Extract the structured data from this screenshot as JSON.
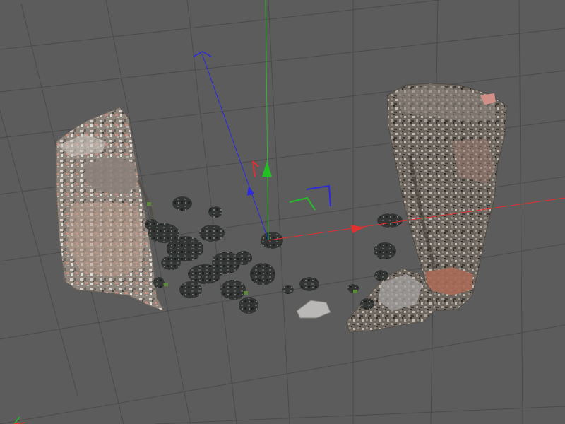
{
  "viewport": {
    "view_name": "3D viewport",
    "background": "#5c5c5c",
    "grid_color": "#4a4a4a",
    "grid_visible": true
  },
  "axes": {
    "x_color": "#e03030",
    "y_color": "#22c022",
    "z_color": "#2a2ae0"
  },
  "scene": {
    "objects": [
      {
        "id": "stone-wall-left",
        "kind": "point-cloud-scan",
        "tone": "#a89f98"
      },
      {
        "id": "stone-wall-right",
        "kind": "point-cloud-scan",
        "tone": "#7e766c"
      },
      {
        "id": "ground-debris",
        "kind": "point-cloud-scan",
        "tone": "#2f3331"
      }
    ]
  }
}
